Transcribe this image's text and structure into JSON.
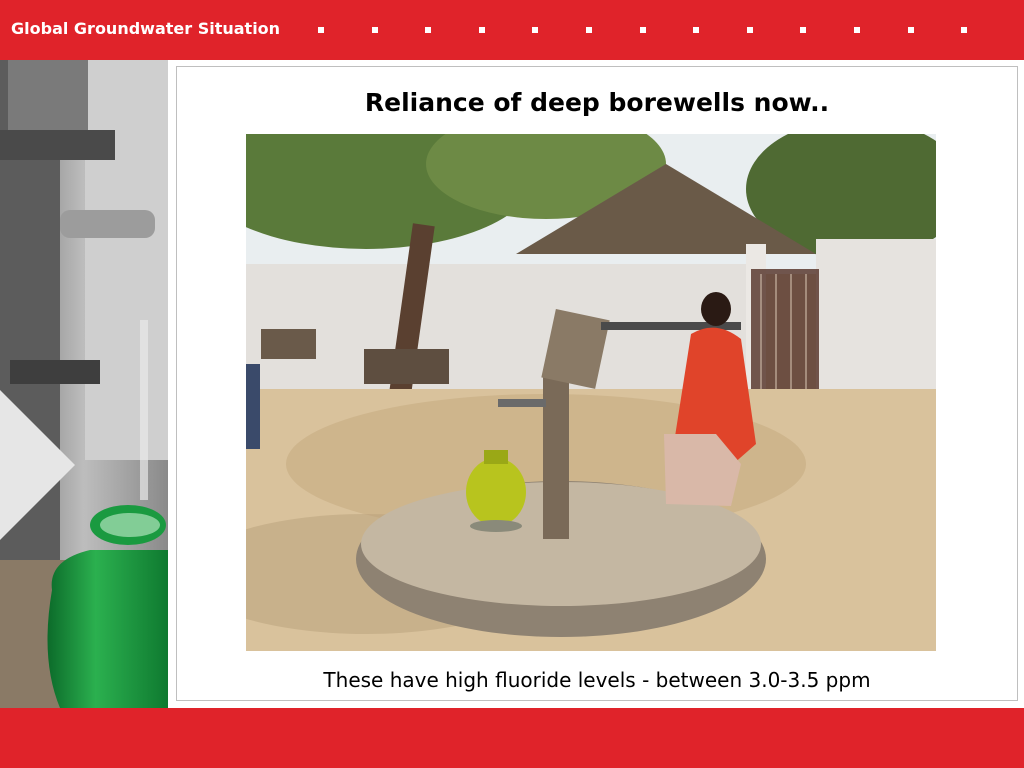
{
  "header": {
    "title": "Global Groundwater Situation",
    "dot_count": 13,
    "color": "#e0232a"
  },
  "slide": {
    "title": "Reliance of deep borewells now..",
    "caption": "These have high fluoride levels - between 3.0-3.5 ppm"
  },
  "icons": {
    "left_panel": "hand-pump-water-pot-photo",
    "main_photo": "village-hand-pump-photo"
  }
}
